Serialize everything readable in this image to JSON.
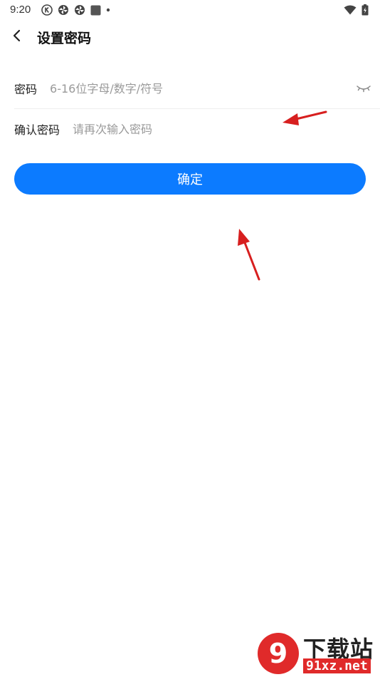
{
  "status_bar": {
    "time": "9:20",
    "left_icons": [
      "k-circle-icon",
      "pinwheel-icon",
      "pinwheel-icon",
      "square-app-icon",
      "dot-icon"
    ],
    "right_icons": [
      "wifi-icon",
      "battery-icon"
    ]
  },
  "header": {
    "title": "设置密码",
    "back_icon": "chevron-left-icon"
  },
  "form": {
    "password": {
      "label": "密码",
      "placeholder": "6-16位字母/数字/符号",
      "toggle_icon": "eye-closed-icon"
    },
    "confirm_password": {
      "label": "确认密码",
      "placeholder": "请再次输入密码"
    }
  },
  "confirm_button": {
    "label": "确定"
  },
  "watermark": {
    "top_text": "下载站",
    "bottom_text": "91xz.net",
    "logo_glyph": "9"
  },
  "colors": {
    "accent": "#0c7bff",
    "annotation_arrow": "#d71f1f",
    "watermark_red": "#e02a2a"
  }
}
